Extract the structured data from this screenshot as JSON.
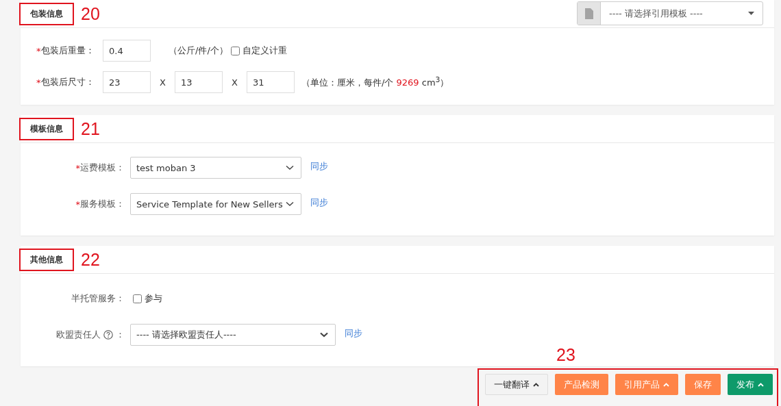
{
  "sections": [
    {
      "title": "包装信息",
      "annotation": "20",
      "template_select": {
        "placeholder": "---- 请选择引用模板 ----"
      },
      "fields": [
        {
          "kind": "weight",
          "label": "包装后重量：",
          "required_mark": "*",
          "value": "0.4",
          "unit": "（公斤/件/个）",
          "checkbox": {
            "label": "自定义计重",
            "checked": false
          }
        },
        {
          "kind": "dimensions",
          "label": "包装后尺寸：",
          "required_mark": "*",
          "values": [
            "23",
            "13",
            "31"
          ],
          "separators": [
            "X",
            "X"
          ],
          "note_prefix": "（单位：厘米，每件/个 ",
          "note_value": "9269",
          "note_suffix": " cm$^{3}$）"
        }
      ]
    },
    {
      "title": "模板信息",
      "annotation": "21",
      "fields": [
        {
          "kind": "select",
          "label": "运费模板：",
          "required_mark": "*",
          "value": "test moban 3",
          "link": "同步"
        },
        {
          "kind": "select",
          "label": "服务模板：",
          "required_mark": "*",
          "value": "Service Template for New Sellers",
          "link": "同步"
        }
      ]
    },
    {
      "title": "其他信息",
      "annotation": "22",
      "fields": [
        {
          "kind": "checkbox",
          "label": "半托管服务：",
          "checkbox": {
            "label": "参与",
            "checked": false
          }
        },
        {
          "kind": "select_help",
          "label": "欧盟责任人",
          "suffix": "：",
          "value": "---- 请选择欧盟责任人----",
          "link": "同步"
        }
      ]
    }
  ],
  "footer": {
    "annotation": "23",
    "buttons": [
      {
        "label": "一键翻译",
        "kind": "default",
        "caret": true
      },
      {
        "label": "产品检测",
        "kind": "warning",
        "caret": false
      },
      {
        "label": "引用产品",
        "kind": "warning",
        "caret": true
      },
      {
        "label": "保存",
        "kind": "warning",
        "caret": false
      },
      {
        "label": "发布",
        "kind": "success",
        "caret": true
      }
    ]
  }
}
